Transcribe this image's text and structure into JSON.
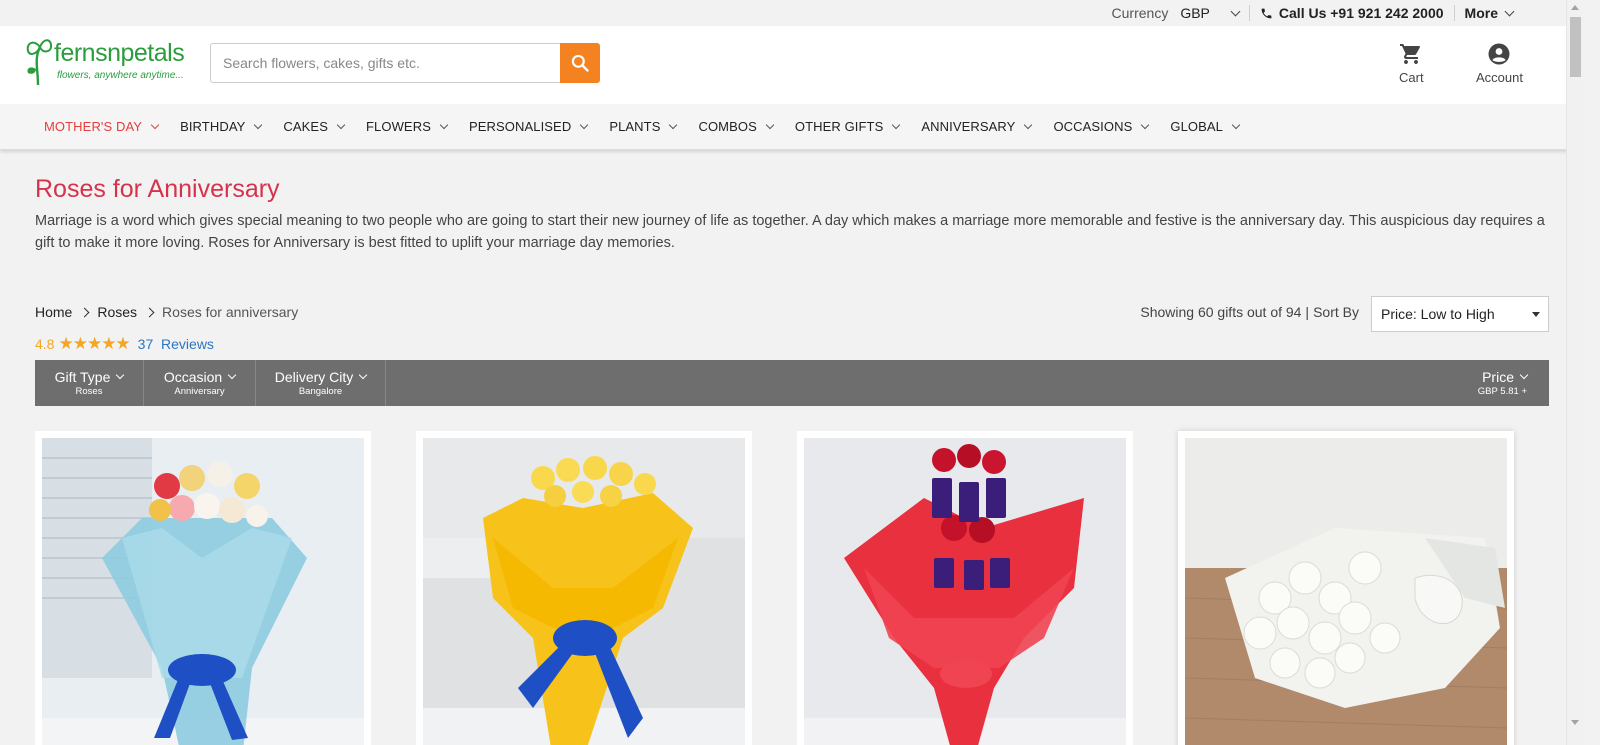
{
  "utilbar": {
    "currency_label": "Currency",
    "currency_value": "GBP",
    "call_us": "Call Us +91 921 242 2000",
    "more": "More"
  },
  "header": {
    "logo_text": "fernsnpetals",
    "logo_tagline": "flowers, anywhere anytime...",
    "search_placeholder": "Search flowers, cakes, gifts etc.",
    "cart_label": "Cart",
    "account_label": "Account"
  },
  "nav": {
    "items": [
      {
        "label": "MOTHER'S DAY"
      },
      {
        "label": "BIRTHDAY"
      },
      {
        "label": "CAKES"
      },
      {
        "label": "FLOWERS"
      },
      {
        "label": "PERSONALISED"
      },
      {
        "label": "PLANTS"
      },
      {
        "label": "COMBOS"
      },
      {
        "label": "OTHER GIFTS"
      },
      {
        "label": "ANNIVERSARY"
      },
      {
        "label": "OCCASIONS"
      },
      {
        "label": "GLOBAL"
      }
    ]
  },
  "page": {
    "title": "Roses for Anniversary",
    "description": "Marriage is a word which gives special meaning to two people who are going to start their new journey of life as together. A day which makes a marriage more memorable and festive is the anniversary day. This auspicious day requires a gift to make it more loving. Roses for Anniversary is best fitted to uplift your marriage day memories."
  },
  "breadcrumb": {
    "home": "Home",
    "roses": "Roses",
    "current": "Roses for anniversary"
  },
  "rating": {
    "value": "4.8",
    "stars": 4.8,
    "review_count": "37",
    "reviews_label": "Reviews"
  },
  "listing": {
    "showing": "Showing 60 gifts out of 94 |",
    "sort_label": "Sort By",
    "sort_value": "Price: Low to High"
  },
  "filters": {
    "gift_type": {
      "label": "Gift Type",
      "value": "Roses"
    },
    "occasion": {
      "label": "Occasion",
      "value": "Anniversary"
    },
    "delivery_city": {
      "label": "Delivery City",
      "value": "Bangalore"
    },
    "price": {
      "label": "Price",
      "value": "GBP  5.81 +"
    }
  },
  "products": [
    {
      "name": "mixed-roses-blue-wrap"
    },
    {
      "name": "yellow-roses-yellow-wrap"
    },
    {
      "name": "red-roses-chocolates-red-wrap"
    },
    {
      "name": "white-roses-bouquet"
    }
  ],
  "colors": {
    "brand_green": "#2a9d3d",
    "accent_orange": "#f58220",
    "title_red": "#d5334c",
    "active_nav_red": "#e53e3e",
    "filterbar_grey": "#6e6e6e",
    "star_gold": "#f5a623",
    "link_blue": "#2f74c0"
  }
}
